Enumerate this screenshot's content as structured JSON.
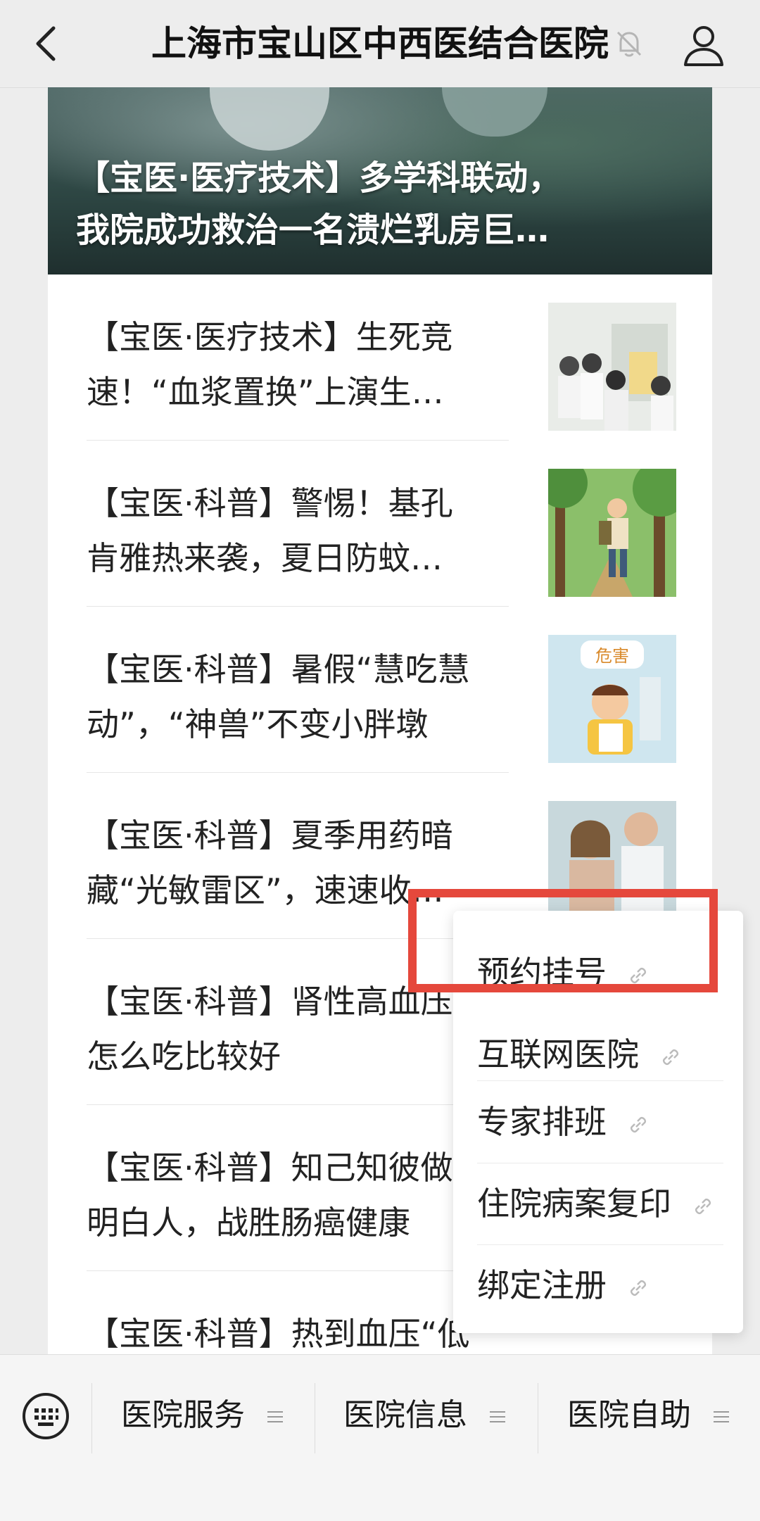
{
  "header": {
    "title": "上海市宝山区中西医结合医院"
  },
  "hero": {
    "title_line1": "【宝医·医疗技术】多学科联动，",
    "title_line2": "我院成功救治一名溃烂乳房巨…"
  },
  "articles": [
    {
      "line1": "【宝医·医疗技术】生死竞",
      "line2": "速！“血浆置换”上演生…"
    },
    {
      "line1": "【宝医·科普】警惕！基孔",
      "line2": "肯雅热来袭，夏日防蚊…"
    },
    {
      "line1": "【宝医·科普】暑假“慧吃慧",
      "line2": "动”，“神兽”不变小胖墩"
    },
    {
      "line1": "【宝医·科普】夏季用药暗",
      "line2": "藏“光敏雷区”，速速收…"
    },
    {
      "line1": "【宝医·科普】肾性高血压",
      "line2": "怎么吃比较好"
    },
    {
      "line1": "【宝医·科普】知己知彼做",
      "line2": "明白人，战胜肠癌健康"
    },
    {
      "line1": "【宝医·科普】热到血压“低",
      "line2": ""
    }
  ],
  "thumb_labels": {
    "danger": "危害"
  },
  "popup_menu": {
    "items": [
      "预约挂号",
      "互联网医院",
      "专家排班",
      "住院病案复印",
      "绑定注册"
    ]
  },
  "bottom_menu": {
    "tabs": [
      "医院服务",
      "医院信息",
      "医院自助"
    ]
  },
  "colors": {
    "highlight": "#e5483c",
    "background": "#ededed"
  }
}
